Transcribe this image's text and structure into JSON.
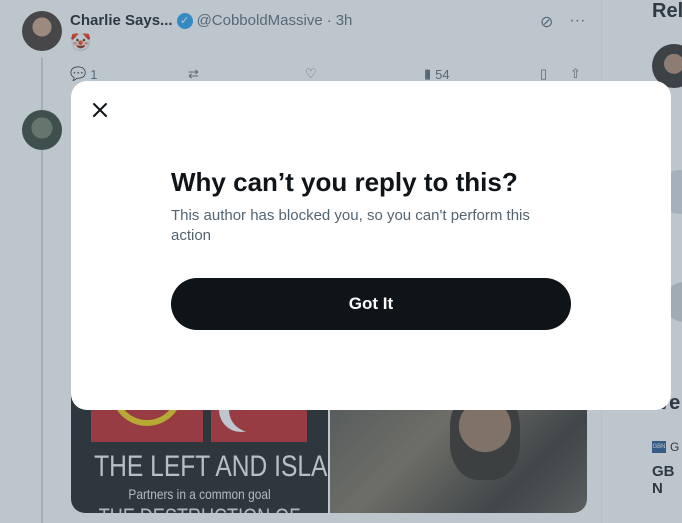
{
  "tweet": {
    "author_name": "Charlie Says...",
    "handle": "@CobboldMassive",
    "separator": "·",
    "time": "3h",
    "content_emoji": "🤡",
    "replies": "1",
    "views": "54"
  },
  "media": {
    "headline": "THE LEFT AND ISLAM",
    "subheadline": "Partners in a common goal",
    "bottom_text": "THE DESTRUCTION OF"
  },
  "right_sidebar": {
    "title_partial": "Rel",
    "section_partial": "ve",
    "source_partial": "G",
    "item_partial": "GB N"
  },
  "dialog": {
    "title": "Why can’t you reply to this?",
    "body": "This author has blocked you, so you can't perform this action",
    "button_label": "Got It"
  },
  "colors": {
    "accent_verified": "#1d9bf0",
    "button_bg": "#0f1419",
    "muted_text": "#536471"
  }
}
